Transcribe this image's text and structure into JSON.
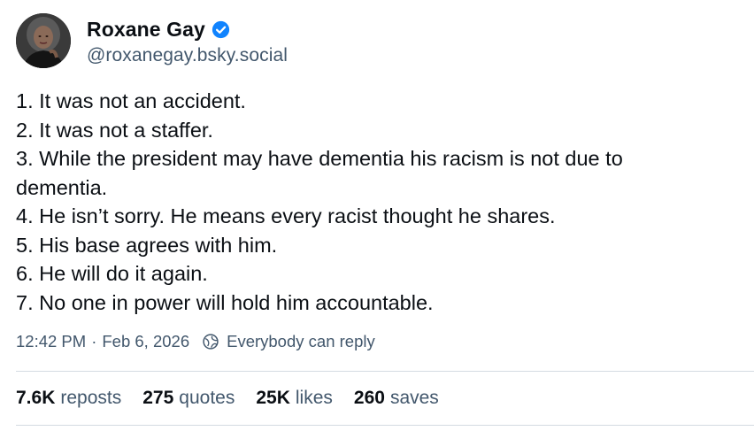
{
  "post": {
    "author": {
      "display_name": "Roxane Gay",
      "handle": "@roxanegay.bsky.social",
      "verified": true
    },
    "body_lines": [
      "1. It was not an accident.",
      "2. It was not a staffer.",
      "3. While the president may have dementia his racism is not due to",
      "dementia.",
      "4. He isn’t sorry. He means every racist thought he shares.",
      "5. His base agrees with him.",
      "6. He will do it again.",
      "7. No one in power will hold him accountable."
    ],
    "time": "12:42 PM",
    "separator": "·",
    "date": "Feb 6, 2026",
    "reply_setting": "Everybody can reply"
  },
  "stats": {
    "reposts": {
      "count": "7.6K",
      "label": "reposts"
    },
    "quotes": {
      "count": "275",
      "label": "quotes"
    },
    "likes": {
      "count": "25K",
      "label": "likes"
    },
    "saves": {
      "count": "260",
      "label": "saves"
    }
  },
  "colors": {
    "text": "#0b0f14",
    "secondary": "#42576c",
    "verified_badge": "#1083fe",
    "divider": "#d4dbe2"
  },
  "icons": {
    "verified": "verified-badge-icon",
    "reply_setting": "earth-icon"
  }
}
